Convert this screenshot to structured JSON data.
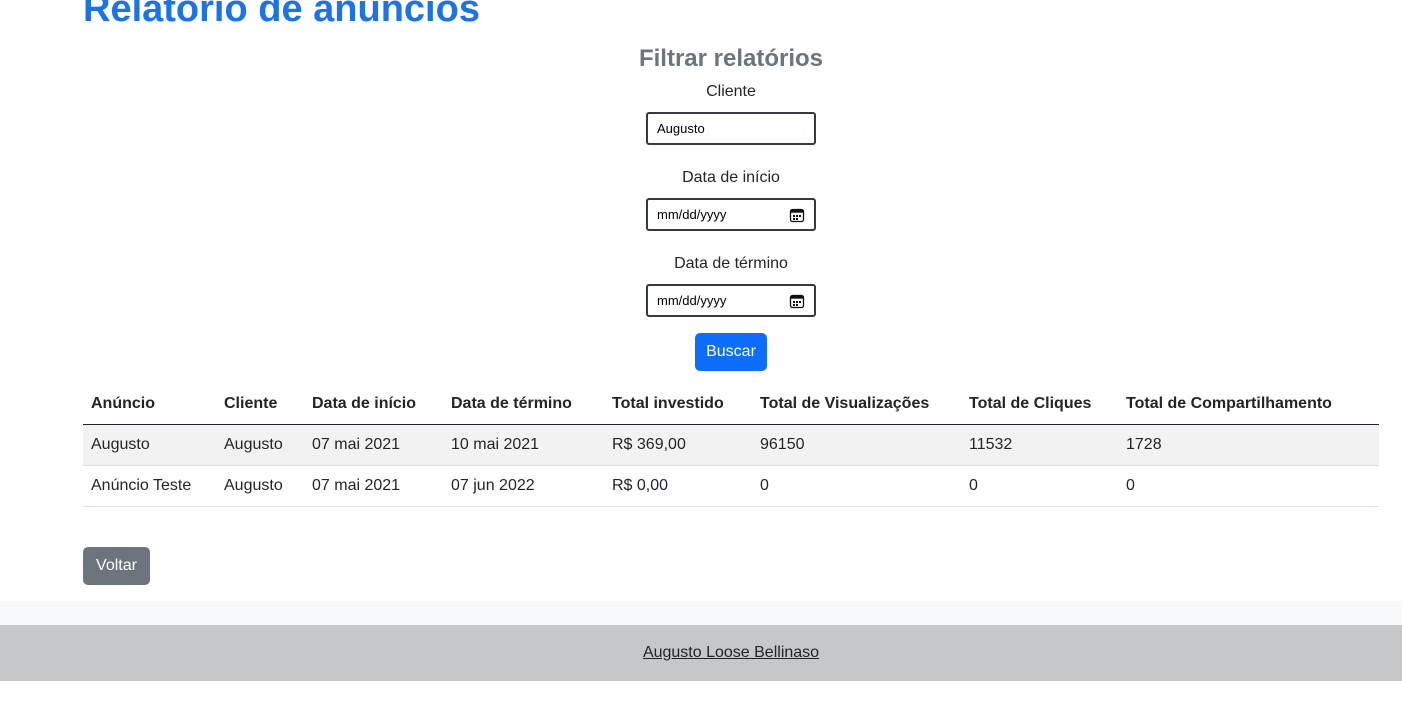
{
  "page": {
    "title": "Relatório de anúncios"
  },
  "filter": {
    "title": "Filtrar relatórios",
    "client": {
      "label": "Cliente",
      "value": "Augusto"
    },
    "start_date": {
      "label": "Data de início",
      "placeholder": "mm/dd/yyyy"
    },
    "end_date": {
      "label": "Data de término",
      "placeholder": "mm/dd/yyyy"
    },
    "search_label": "Buscar"
  },
  "table": {
    "headers": [
      "Anúncio",
      "Cliente",
      "Data de início",
      "Data de término",
      "Total investido",
      "Total de Visualizações",
      "Total de Cliques",
      "Total de Compartilhamento"
    ],
    "rows": [
      [
        "Augusto",
        "Augusto",
        "07 mai 2021",
        "10 mai 2021",
        "R$ 369,00",
        "96150",
        "11532",
        "1728"
      ],
      [
        "Anúncio Teste",
        "Augusto",
        "07 mai 2021",
        "07 jun 2022",
        "R$ 0,00",
        "0",
        "0",
        "0"
      ]
    ]
  },
  "back_label": "Voltar",
  "footer": {
    "author": "Augusto Loose Bellinaso"
  },
  "icons": {
    "calendar": "calendar-icon"
  },
  "colors": {
    "primary": "#0d6efd",
    "title": "#1a73e8",
    "secondary": "#6c757d",
    "footer": "#c6c7c8"
  }
}
